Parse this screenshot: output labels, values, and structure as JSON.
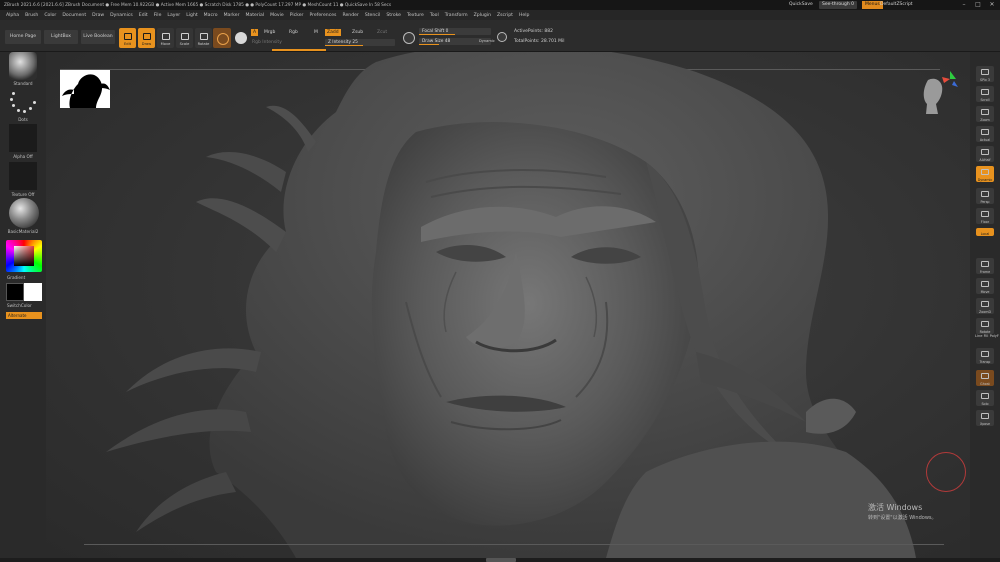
{
  "titlebar": {
    "title": "ZBrush 2021.6.6 [2021.6.6]   ZBrush Document   ● Free Mem 10.922GB ● Active Mem 1665 ● Scratch Disk 1785 ●   ● PolyCount 17.297 MP ● MeshCount 11   ● QuickSave In 58 Secs",
    "quicksave": "QuickSave",
    "see_through": "See-through  0",
    "menus": "Menus",
    "default_zscript": "DefaultZScript"
  },
  "menubar": {
    "items": [
      "Alpha",
      "Brush",
      "Color",
      "Document",
      "Draw",
      "Dynamics",
      "Edit",
      "File",
      "Layer",
      "Light",
      "Macro",
      "Marker",
      "Material",
      "Movie",
      "Picker",
      "Preferences",
      "Render",
      "Stencil",
      "Stroke",
      "Texture",
      "Tool",
      "Transform",
      "Zplugin",
      "Zscript",
      "Help"
    ]
  },
  "shelf": {
    "home_page": "Home Page",
    "lightbox": "LightBox",
    "live_boolean": "Live Boolean",
    "edit": "Edit",
    "draw": "Draw",
    "move": "Move",
    "scale": "Scale",
    "rotate": "Rotate",
    "a_btn": "A",
    "mrgb": "Mrgb",
    "rgb": "Rgb",
    "m": "M",
    "rgb_intensity": "Rgb Intensity",
    "zadd": "Zadd",
    "zsub": "Zsub",
    "zcut": "Zcut",
    "z_intensity": "Z Intensity 25",
    "focal_shift": "Focal Shift 0",
    "draw_size": "Draw Size 48",
    "dynamic": "Dynamic",
    "active_points": "ActivePoints: 882",
    "total_points": "TotalPoints: 28.701 Mil"
  },
  "lefttray": {
    "brush": "Standard",
    "stroke": "Dots",
    "alpha": "Alpha Off",
    "texture": "Texture Off",
    "material": "BasicMaterial2",
    "gradient": "Gradient",
    "switch_color": "SwitchColor",
    "alternate": "Alternate"
  },
  "righttray": {
    "buttons": [
      "SPix 3",
      "Scroll",
      "Zoom",
      "Actual",
      "AAHalf",
      "Dynamic",
      "Persp",
      "Floor",
      "Local",
      "Frame",
      "Move",
      "ZoomD",
      "Rotate",
      "Line Fill PolyF",
      "Transp",
      "Ghost",
      "Solo",
      "Xpose"
    ]
  },
  "canvas": {
    "watermark_title": "激活 Windows",
    "watermark_sub": "转到\"设置\"以激活 Windows。"
  },
  "colors": {
    "accent": "#e8921e",
    "panel": "#2a2a2a",
    "canvas": "#3a3a3a",
    "sculpt": "#5b5b5b"
  }
}
